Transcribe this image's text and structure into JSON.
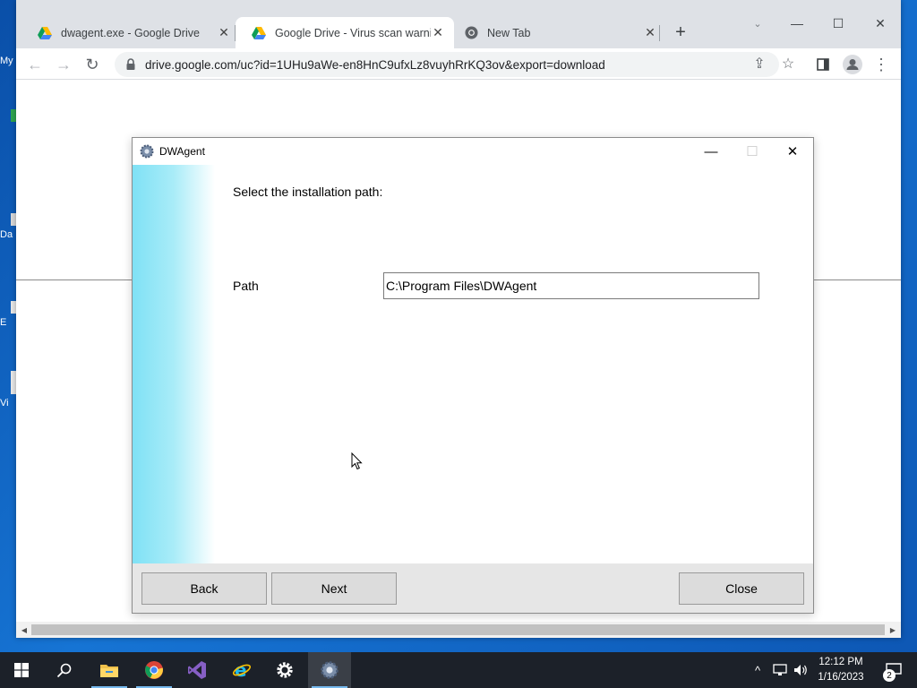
{
  "desktop": {
    "icons": [
      {
        "label": "My"
      },
      {
        "label": "Da"
      },
      {
        "label": "E"
      },
      {
        "label": "Vi"
      }
    ]
  },
  "browser": {
    "tabs": [
      {
        "title": "dwagent.exe - Google Drive",
        "icon": "google-drive-icon",
        "active": false
      },
      {
        "title": "Google Drive - Virus scan warnin",
        "icon": "google-drive-icon",
        "active": true
      },
      {
        "title": "New Tab",
        "icon": "chrome-icon",
        "active": false
      }
    ],
    "url": "drive.google.com/uc?id=1UHu9aWe-en8HnC9ufxLz8vuyhRrKQ3ov&export=download"
  },
  "dialog": {
    "title": "DWAgent",
    "heading": "Select the installation path:",
    "path_label": "Path",
    "path_value": "C:\\Program Files\\DWAgent",
    "buttons": {
      "back": "Back",
      "next": "Next",
      "close": "Close"
    }
  },
  "taskbar": {
    "time": "12:12 PM",
    "date": "1/16/2023",
    "notification_count": "2",
    "pinned": [
      "start-icon",
      "search-icon",
      "file-explorer-icon",
      "chrome-icon",
      "visual-studio-icon",
      "internet-explorer-icon",
      "settings-icon",
      "dwagent-icon"
    ]
  },
  "colors": {
    "desktop_blue": "#0d56b3",
    "tabbar": "#dee1e6",
    "dialog_side_cyan": "#7fe1f5",
    "taskbar": "#1c2129"
  }
}
